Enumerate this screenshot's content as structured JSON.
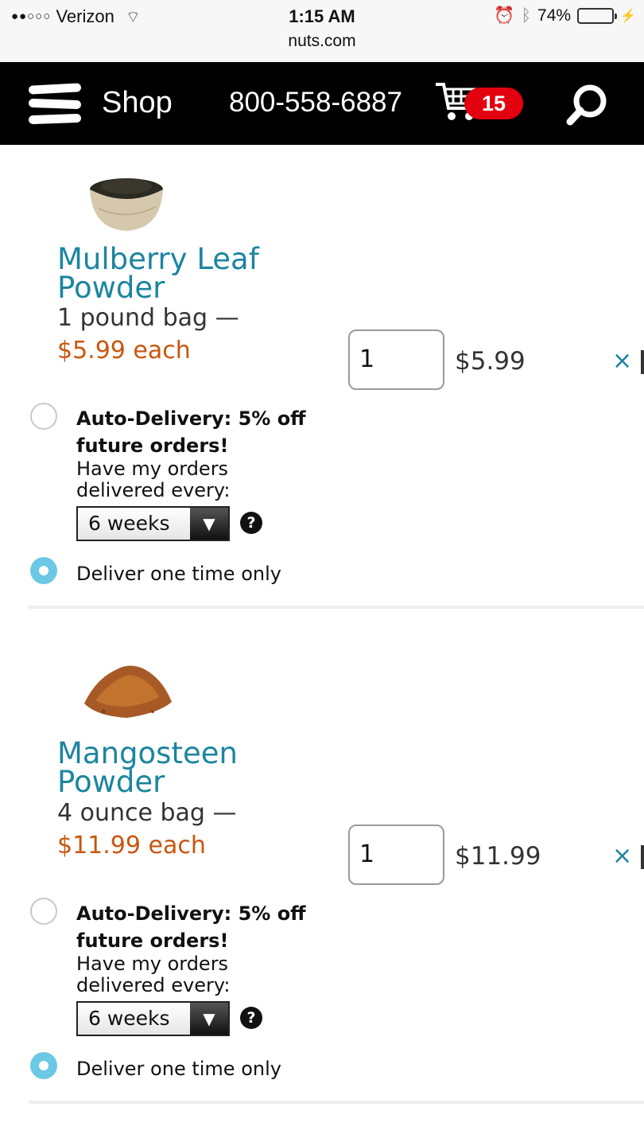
{
  "status_bar": {
    "signal": "●●○○○",
    "carrier": "Verizon",
    "wifi_glyph": "⌔",
    "time": "1:15 AM",
    "url": "nuts.com",
    "alarm_glyph": "⏰",
    "bluetooth_glyph": "ᛒ",
    "battery_percent": "74%",
    "battery_level": 0.74,
    "charging_glyph": "⚡"
  },
  "nav": {
    "shop_label": "Shop",
    "phone": "800-558-6887",
    "cart_count": "15"
  },
  "colors": {
    "link": "#1c85a0",
    "price": "#c9560d",
    "badge": "#e3000f",
    "radio_selected": "#6cc8e4"
  },
  "items": [
    {
      "name": "Mulberry Leaf Powder",
      "size": "1 pound bag —",
      "unit_price": "$5.99 each",
      "quantity": "1",
      "line_total": "$5.99",
      "remove_glyph": "×",
      "auto_delivery_title": "Auto-Delivery: 5% off future orders!",
      "auto_delivery_sub": "Have my orders delivered every:",
      "frequency": "6 weeks",
      "dropdown_glyph": "▼",
      "help_glyph": "?",
      "one_time_label": "Deliver one time only",
      "auto_delivery_selected": false,
      "one_time_selected": true
    },
    {
      "name": "Mangosteen Powder",
      "size": "4 ounce bag —",
      "unit_price": "$11.99 each",
      "quantity": "1",
      "line_total": "$11.99",
      "remove_glyph": "×",
      "auto_delivery_title": "Auto-Delivery: 5% off future orders!",
      "auto_delivery_sub": "Have my orders delivered every:",
      "frequency": "6 weeks",
      "dropdown_glyph": "▼",
      "help_glyph": "?",
      "one_time_label": "Deliver one time only",
      "auto_delivery_selected": false,
      "one_time_selected": true
    }
  ]
}
